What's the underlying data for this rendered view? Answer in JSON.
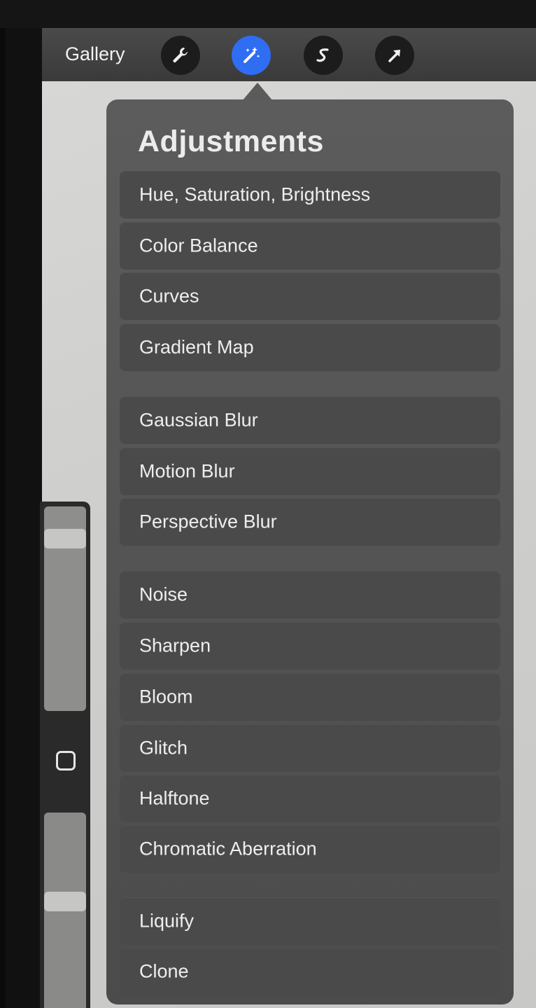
{
  "toolbar": {
    "gallery_label": "Gallery",
    "tools": [
      {
        "icon": "wrench-icon",
        "active": false
      },
      {
        "icon": "magic-wand-icon",
        "active": true
      },
      {
        "icon": "selection-icon",
        "active": false
      },
      {
        "icon": "transform-arrow-icon",
        "active": false
      }
    ],
    "active_color": "#2f6df2"
  },
  "adjustments": {
    "title": "Adjustments",
    "groups": [
      [
        "Hue, Saturation, Brightness",
        "Color Balance",
        "Curves",
        "Gradient Map"
      ],
      [
        "Gaussian Blur",
        "Motion Blur",
        "Perspective Blur"
      ],
      [
        "Noise",
        "Sharpen",
        "Bloom",
        "Glitch",
        "Halftone",
        "Chromatic Aberration"
      ],
      [
        "Liquify",
        "Clone"
      ]
    ]
  },
  "sidebar": {
    "brush_size_slider": {
      "level": 0.88
    },
    "opacity_slider": {
      "level": 0.55
    },
    "modify_button_icon": "square-icon"
  }
}
